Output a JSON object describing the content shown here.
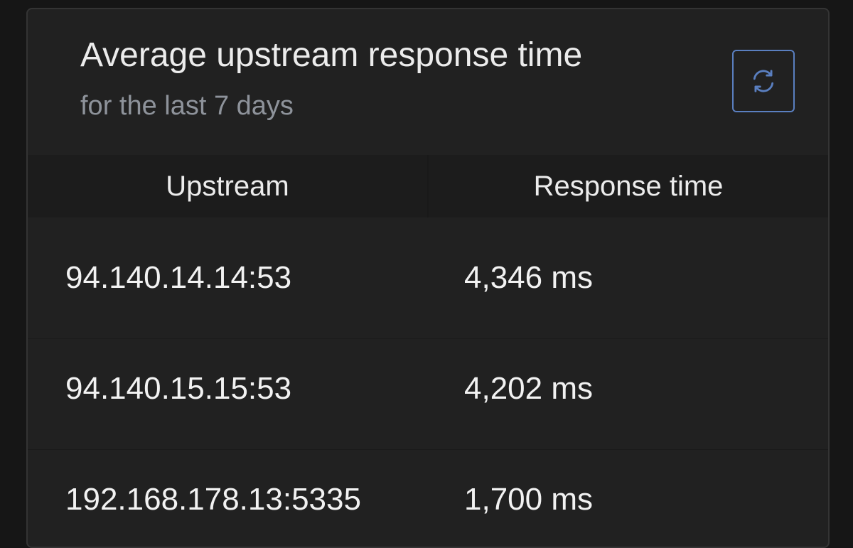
{
  "card": {
    "title": "Average upstream response time",
    "subtitle": "for the last 7 days",
    "refresh_icon": "refresh-icon"
  },
  "table": {
    "headers": {
      "upstream": "Upstream",
      "response_time": "Response time"
    },
    "rows": [
      {
        "upstream": "94.140.14.14:53",
        "response_time": "4,346 ms"
      },
      {
        "upstream": "94.140.15.15:53",
        "response_time": "4,202 ms"
      },
      {
        "upstream": "192.168.178.13:5335",
        "response_time": "1,700 ms"
      }
    ]
  },
  "colors": {
    "accent": "#5a7fc0",
    "background": "#161616",
    "card": "#212121"
  }
}
